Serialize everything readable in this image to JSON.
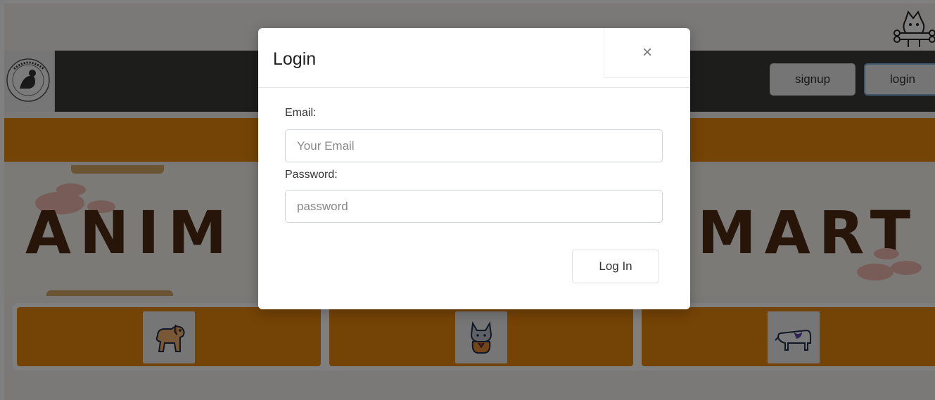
{
  "navbar": {
    "signup_label": "signup",
    "login_label": "login",
    "logo_text": "ANIMAL TRADE MART"
  },
  "banner": {
    "text_left": "ANIM",
    "text_right": "MART"
  },
  "categories": [
    {
      "name": "dog",
      "icon": "dog-icon"
    },
    {
      "name": "cat",
      "icon": "cat-icon"
    },
    {
      "name": "cow",
      "icon": "cow-icon"
    }
  ],
  "modal": {
    "title": "Login",
    "close_symbol": "×",
    "email_label": "Email:",
    "email_placeholder": "Your Email",
    "email_value": "",
    "password_label": "Password:",
    "password_placeholder": "password",
    "password_value": "",
    "submit_label": "Log In"
  },
  "colors": {
    "accent_orange": "#e9860d",
    "navbar_dark": "#3b3a36",
    "banner_text": "#4f2a12",
    "paw_pink": "#f0b9ae",
    "overlay": "rgba(0,0,0,0.5)"
  }
}
